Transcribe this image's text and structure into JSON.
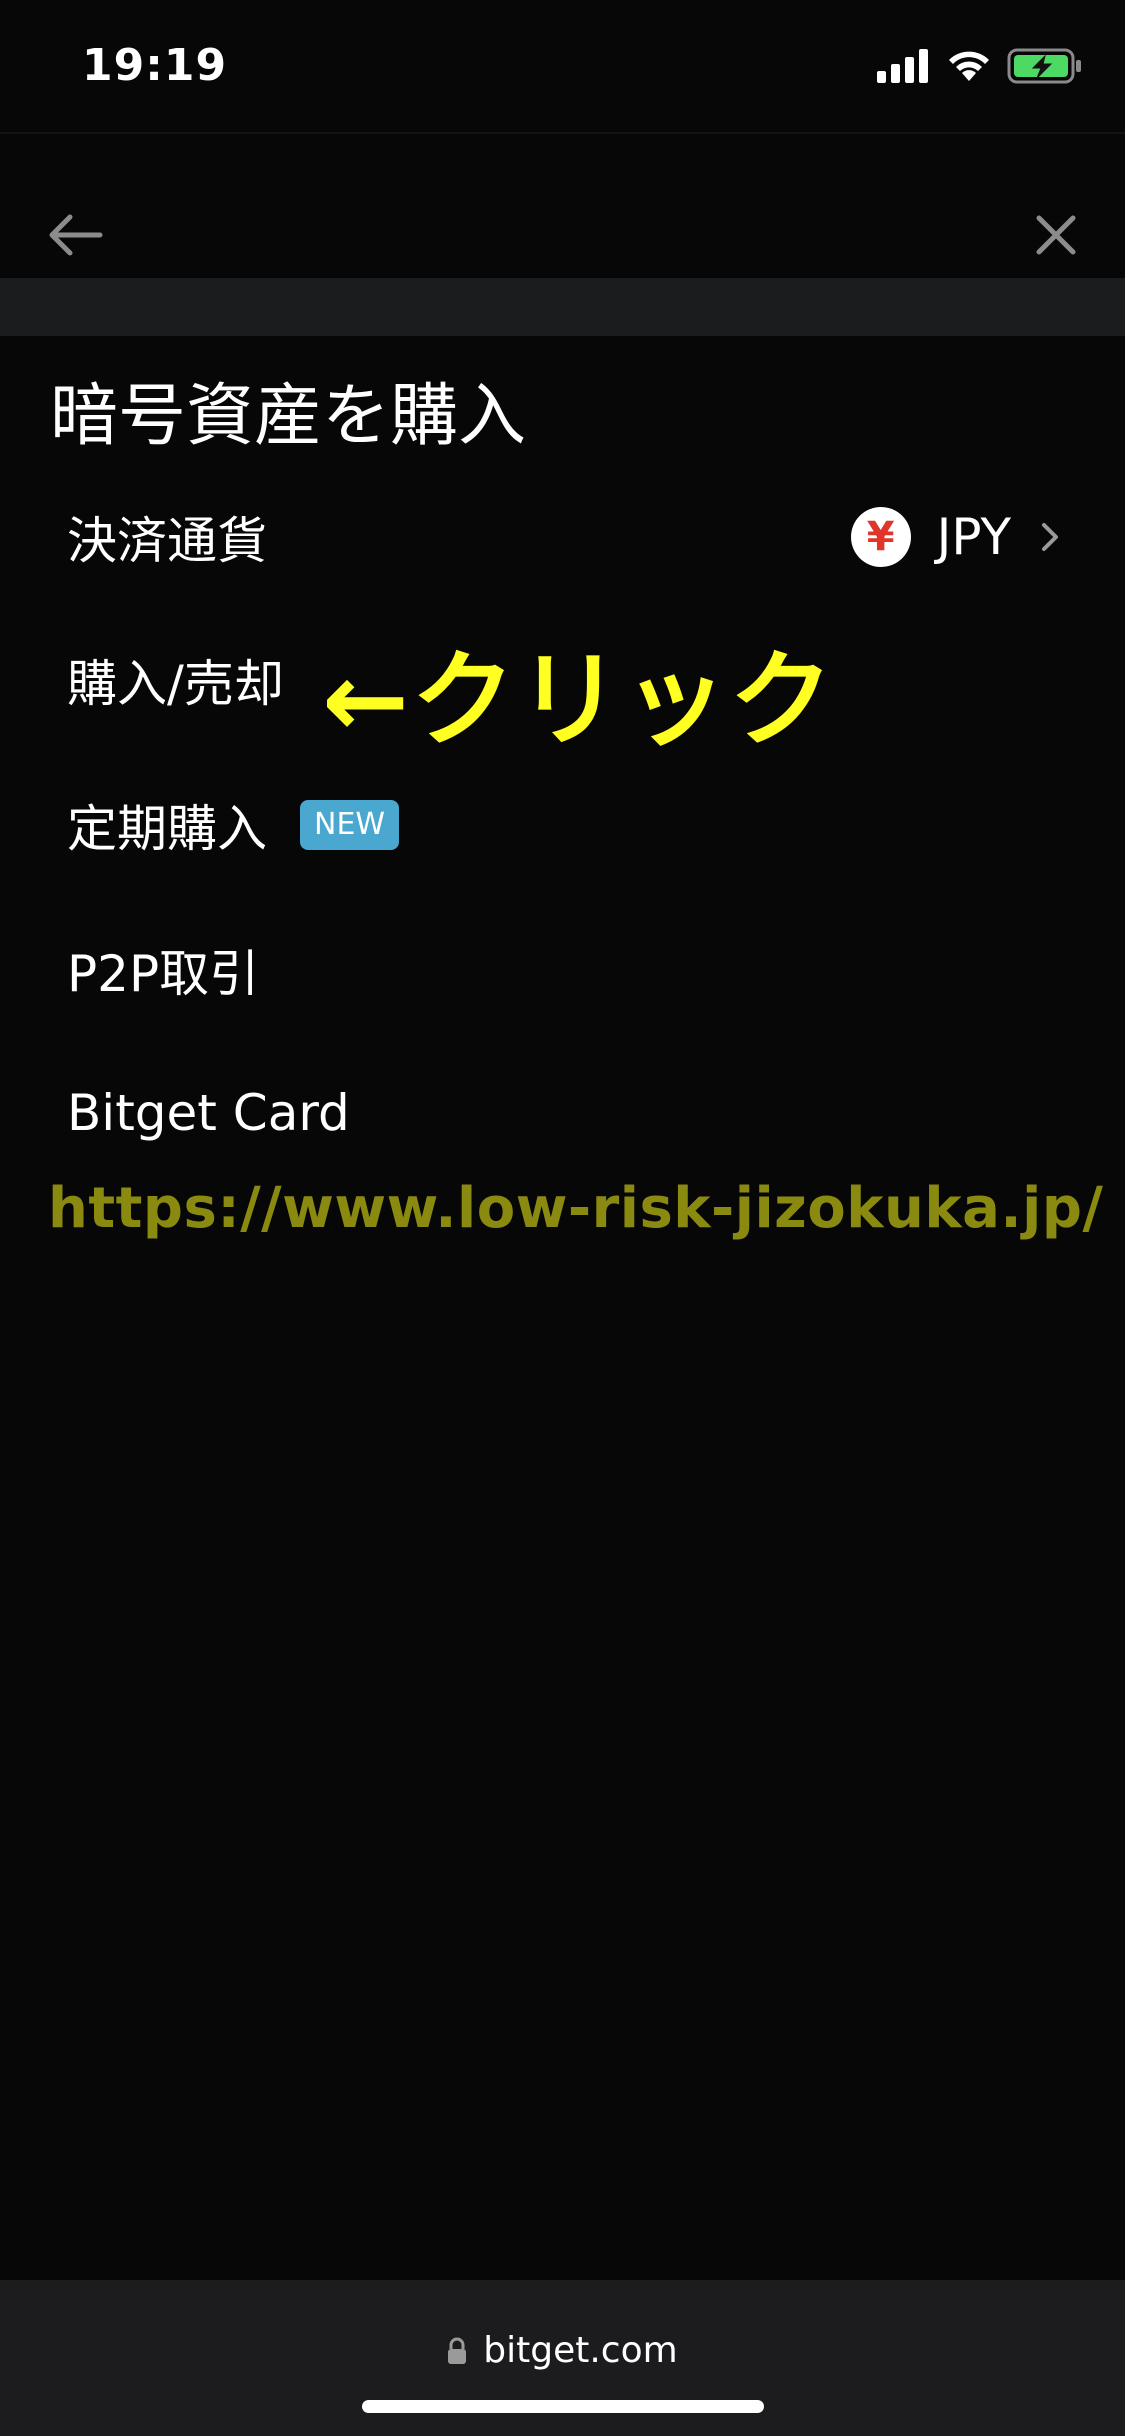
{
  "status_bar": {
    "time": "19:19"
  },
  "page": {
    "title": "暗号資産を購入"
  },
  "menu": {
    "items": [
      {
        "label": "決済通貨"
      },
      {
        "label": "購入/売却"
      },
      {
        "label": "定期購入",
        "badge": "NEW"
      },
      {
        "label": "P2P取引"
      },
      {
        "label": "Bitget Card"
      }
    ],
    "currency": {
      "symbol": "¥",
      "code": "JPY"
    }
  },
  "annotation": {
    "text": "←クリック"
  },
  "watermark": {
    "text": "https://www.low-risk-jizokuka.jp/"
  },
  "browser": {
    "domain": "bitget.com"
  },
  "colors": {
    "background": "#070707",
    "annotation": "#ffff22",
    "watermark": "#8b8a10",
    "badge": "#4aa7cf",
    "battery": "#4cd964",
    "yen_symbol": "#e0352b"
  },
  "icons": {
    "back": "arrow-left-icon",
    "close": "close-icon",
    "chevron": "chevron-right-icon",
    "lock": "lock-icon",
    "signal": "cellular-signal-icon",
    "wifi": "wifi-icon",
    "battery": "battery-charging-icon"
  }
}
